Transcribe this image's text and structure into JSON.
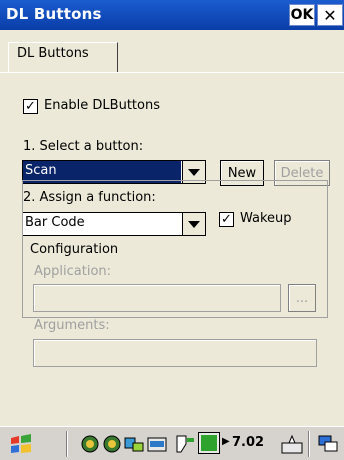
{
  "window": {
    "title": "DL Buttons",
    "ok_label": "OK",
    "close_glyph": "✕"
  },
  "tabs": [
    {
      "label": "DL Buttons"
    }
  ],
  "form": {
    "enable": {
      "label": "Enable DLButtons",
      "checked": true
    },
    "select_button": {
      "label": "1. Select a button:",
      "value": "Scan"
    },
    "new_label": "New",
    "delete_label": "Delete",
    "assign_function": {
      "label": "2. Assign a function:",
      "value": "Bar Code"
    },
    "wakeup": {
      "label": "Wakeup",
      "checked": true
    },
    "configuration": {
      "title": "Configuration",
      "application_label": "Application:",
      "browse_label": "...",
      "arguments_label": "Arguments:"
    }
  },
  "taskbar": {
    "battery": {
      "level": 1.0
    },
    "value": "7.02"
  }
}
